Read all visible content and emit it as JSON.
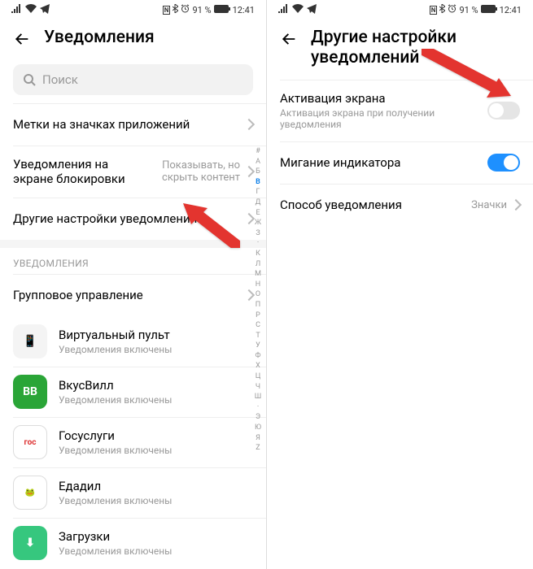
{
  "status": {
    "signal_icon": "signal",
    "wifi_icon": "wifi",
    "telegram_icon": "telegram",
    "nfc_icon": "N",
    "bt_icon": "bt",
    "alarm_icon": "alarm",
    "battery_pct": "91 %",
    "time": "12:41"
  },
  "left": {
    "title": "Уведомления",
    "search_placeholder": "Поиск",
    "rows": {
      "badges": "Метки на значках приложений",
      "lockscreen_title": "Уведомления на экране блокировки",
      "lockscreen_value": "Показывать, но скрыть контент",
      "more": "Другие настройки уведомлений"
    },
    "section_header": "УВЕДОМЛЕНИЯ",
    "group_mgmt": "Групповое управление",
    "apps": [
      {
        "name": "Виртуальный пульт",
        "sub": "Уведомления включены",
        "iconBg": "#f4f4f4",
        "iconText": "📱"
      },
      {
        "name": "ВкусВилл",
        "sub": "Уведомления включены",
        "iconBg": "#2aa537",
        "iconText": "ВВ"
      },
      {
        "name": "Госуслуги",
        "sub": "Уведомления включены",
        "iconBg": "#ffffff",
        "iconText": "гос"
      },
      {
        "name": "Едадил",
        "sub": "Уведомления включены",
        "iconBg": "#ffffff",
        "iconText": "🐸"
      },
      {
        "name": "Загрузки",
        "sub": "Уведомления включены",
        "iconBg": "#36c77e",
        "iconText": "⬇"
      }
    ],
    "index": [
      "#",
      "А",
      "Б",
      "В",
      "Г",
      "Д",
      "Е",
      "Ж",
      "З",
      "·",
      "К",
      "Л",
      "М",
      "Н",
      "О",
      "П",
      "Р",
      "С",
      "Т",
      "У",
      "Ф",
      "Х",
      "Ц",
      "Ч",
      "Ш",
      "·",
      "Э",
      "Ю",
      "Я",
      "Z"
    ]
  },
  "right": {
    "title": "Другие настройки уведомлений",
    "rows": {
      "wake_title": "Активация экрана",
      "wake_sub": "Активация экрана при получении уведомления",
      "led": "Мигание индикатора",
      "method_title": "Способ уведомления",
      "method_value": "Значки"
    }
  }
}
